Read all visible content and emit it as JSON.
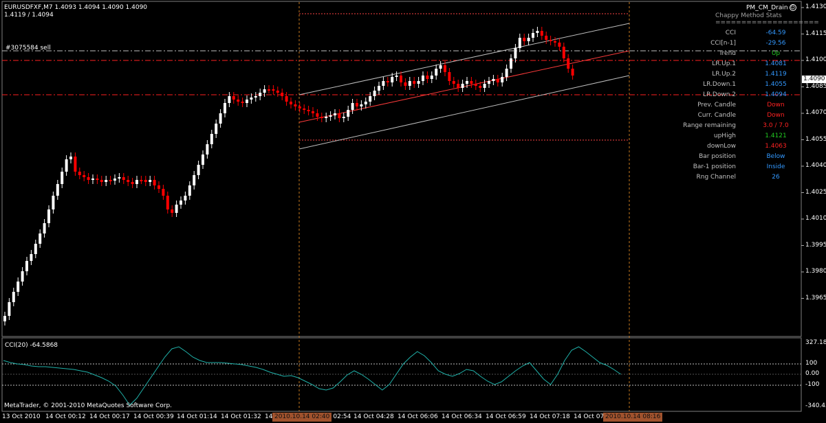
{
  "header": {
    "symbol_line": "EURUSDFXF,M7  1.4093 1.4094 1.4090 1.4090",
    "bid_ask": "1.4119 / 1.4094",
    "order_label": "#3075584 sell"
  },
  "expert": {
    "name": "PM_CM_Drain",
    "icon": "smiley-icon"
  },
  "stats": {
    "title": "Chappy Method Stats",
    "separator": "====================",
    "rows": [
      {
        "label": "CCI",
        "value": "-64.59",
        "color": "#3399ff"
      },
      {
        "label": "CCI[n-1]",
        "value": "-29.56",
        "color": "#3399ff"
      },
      {
        "label": "Trend",
        "value": "Up",
        "color": "#22cc22"
      },
      {
        "label": "LR.Up.1",
        "value": "1.4081",
        "color": "#3399ff"
      },
      {
        "label": "LR.Up.2",
        "value": "1.4119",
        "color": "#3399ff"
      },
      {
        "label": "LR.Down.1",
        "value": "1.4055",
        "color": "#3399ff"
      },
      {
        "label": "LR.Down.2",
        "value": "1.4094",
        "color": "#3399ff"
      },
      {
        "label": "Prev. Candle",
        "value": "Down",
        "color": "#ff2222"
      },
      {
        "label": "Curr. Candle",
        "value": "Down",
        "color": "#ff2222"
      },
      {
        "label": "Range remaining",
        "value": "3.0 / 7.0",
        "color": "#ff2222"
      },
      {
        "label": "upHigh",
        "value": "1.4121",
        "color": "#22cc22"
      },
      {
        "label": "downLow",
        "value": "1.4063",
        "color": "#ff2222"
      },
      {
        "label": "Bar position",
        "value": "Below",
        "color": "#3399ff"
      },
      {
        "label": "Bar-1 position",
        "value": "Inside",
        "color": "#3399ff"
      },
      {
        "label": "Rng Channel",
        "value": "26",
        "color": "#3399ff"
      }
    ]
  },
  "price_axis": {
    "labels": [
      "1.4130",
      "1.4115",
      "1.4100",
      "1.4085",
      "1.4070",
      "1.4055",
      "1.4040",
      "1.4025",
      "1.4010",
      "1.3995",
      "1.3980",
      "1.3965"
    ],
    "current_price": "1.4090"
  },
  "cci_panel": {
    "title": "CCI(20) -64.5868",
    "levels": [
      "327.184",
      "100",
      "0.00",
      "-100",
      "-340.453"
    ]
  },
  "copyright": "MetaTrader, © 2001-2010 MetaQuotes Software Corp.",
  "time_axis": {
    "labels": [
      "13 Oct 2010",
      "14 Oct 00:12",
      "14 Oct 00:17",
      "14 Oct 00:39",
      "14 Oct 01:14",
      "14 Oct 01:32",
      "14",
      "t 02:54",
      "14 Oct 04:28",
      "14 Oct 06:06",
      "14 Oct 06:34",
      "14 Oct 06:59",
      "14 Oct 07:18",
      "14 Oct 07"
    ],
    "highlight_start": "2010.10.14 02:40",
    "highlight_end": "2010.10.14 08:16"
  },
  "colors": {
    "bull": "#ffffff",
    "bear": "#ff0000",
    "cci_line": "#20b2aa",
    "channel": "#c0c0c0",
    "grid_red": "#ff0000",
    "range_line": "#ff4444"
  }
}
